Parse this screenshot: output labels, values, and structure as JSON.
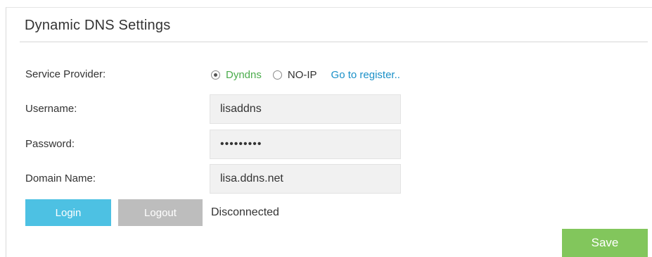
{
  "section": {
    "title": "Dynamic DNS Settings"
  },
  "service_provider": {
    "label": "Service Provider:",
    "options": [
      {
        "label": "Dyndns",
        "selected": true
      },
      {
        "label": "NO-IP",
        "selected": false
      }
    ],
    "register_link": "Go to register.."
  },
  "username": {
    "label": "Username:",
    "value": "lisaddns"
  },
  "password": {
    "label": "Password:",
    "value": "•••••••••"
  },
  "domain_name": {
    "label": "Domain Name:",
    "value": "lisa.ddns.net"
  },
  "actions": {
    "login_label": "Login",
    "logout_label": "Logout",
    "status": "Disconnected",
    "save_label": "Save"
  },
  "colors": {
    "selected_option": "#4bac4c",
    "link": "#1a90c8",
    "login_button": "#4dc1e3",
    "logout_button": "#bdbdbd",
    "save_button": "#82c65c"
  }
}
